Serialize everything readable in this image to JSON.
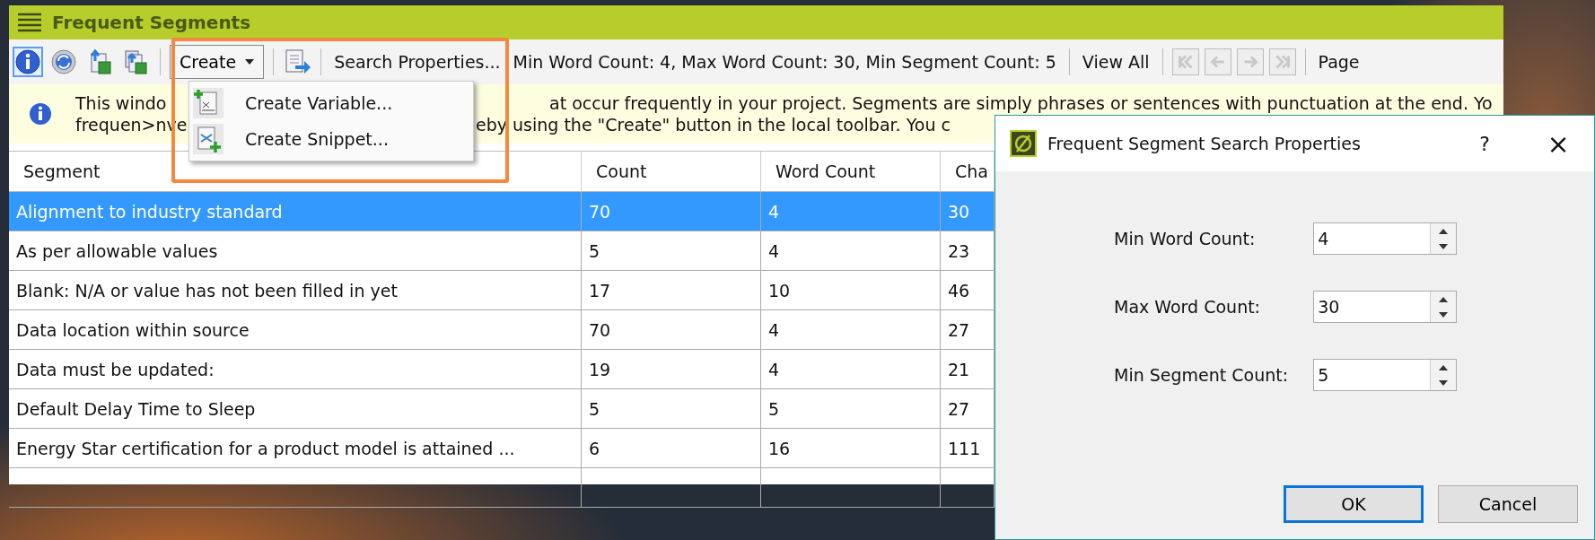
{
  "window": {
    "title": "Frequent Segments"
  },
  "toolbar": {
    "icons": [
      {
        "kind": "info",
        "selected": true
      },
      {
        "kind": "refresh",
        "selected": false
      },
      {
        "kind": "export",
        "selected": false
      },
      {
        "kind": "export-all",
        "selected": false
      }
    ],
    "create_button": "Create",
    "search_properties": "Search Properties...",
    "summary": "Min Word Count: 4, Max Word Count: 30, Min Segment Count: 5",
    "view_all": "View All",
    "nav_buttons": [
      {
        "kind": "first",
        "disabled": true
      },
      {
        "kind": "prev",
        "disabled": true
      },
      {
        "kind": "next",
        "disabled": true
      },
      {
        "kind": "last",
        "disabled": true
      }
    ],
    "page_label": "Page"
  },
  "info_bar": {
    "lines": [
      [
        "This windo",
        "at occur frequently in your project. Segments are simply phrases or sentences with punctuation at the end. Yo"
      ],
      [
        "frequen>nve",
        "eby using the \"Create\" button in the local toolbar. You c"
      ]
    ]
  },
  "create_menu": {
    "items": [
      {
        "kind": "variable",
        "label": "Create Variable..."
      },
      {
        "kind": "snippet",
        "label": "Create Snippet..."
      }
    ]
  },
  "table": {
    "columns": [
      "Segment",
      "Count",
      "Word Count",
      "Cha"
    ],
    "rows": [
      {
        "cells": [
          "Alignment to industry standard",
          "70",
          "4",
          "30"
        ],
        "selected": true
      },
      {
        "cells": [
          "As per allowable values",
          "5",
          "4",
          "23"
        ],
        "selected": false
      },
      {
        "cells": [
          "Blank: N/A or value has not been filled in yet",
          "17",
          "10",
          "46"
        ],
        "selected": false
      },
      {
        "cells": [
          "Data location within source",
          "70",
          "4",
          "27"
        ],
        "selected": false
      },
      {
        "cells": [
          "Data must be updated:",
          "19",
          "4",
          "21"
        ],
        "selected": false
      },
      {
        "cells": [
          "Default Delay Time to Sleep",
          "5",
          "5",
          "27"
        ],
        "selected": false
      },
      {
        "cells": [
          "Energy Star certification for a product model is attained ...",
          "6",
          "16",
          "111"
        ],
        "selected": false
      }
    ]
  },
  "dialog": {
    "title": "Frequent Segment Search Properties",
    "help": "?",
    "close": "×",
    "fields": [
      {
        "label": "Min Word Count:",
        "value": "4"
      },
      {
        "label": "Max Word Count:",
        "value": "30"
      },
      {
        "label": "Min Segment Count:",
        "value": "5"
      }
    ],
    "buttons": [
      {
        "label": "OK",
        "default": true
      },
      {
        "label": "Cancel",
        "default": false
      }
    ]
  }
}
